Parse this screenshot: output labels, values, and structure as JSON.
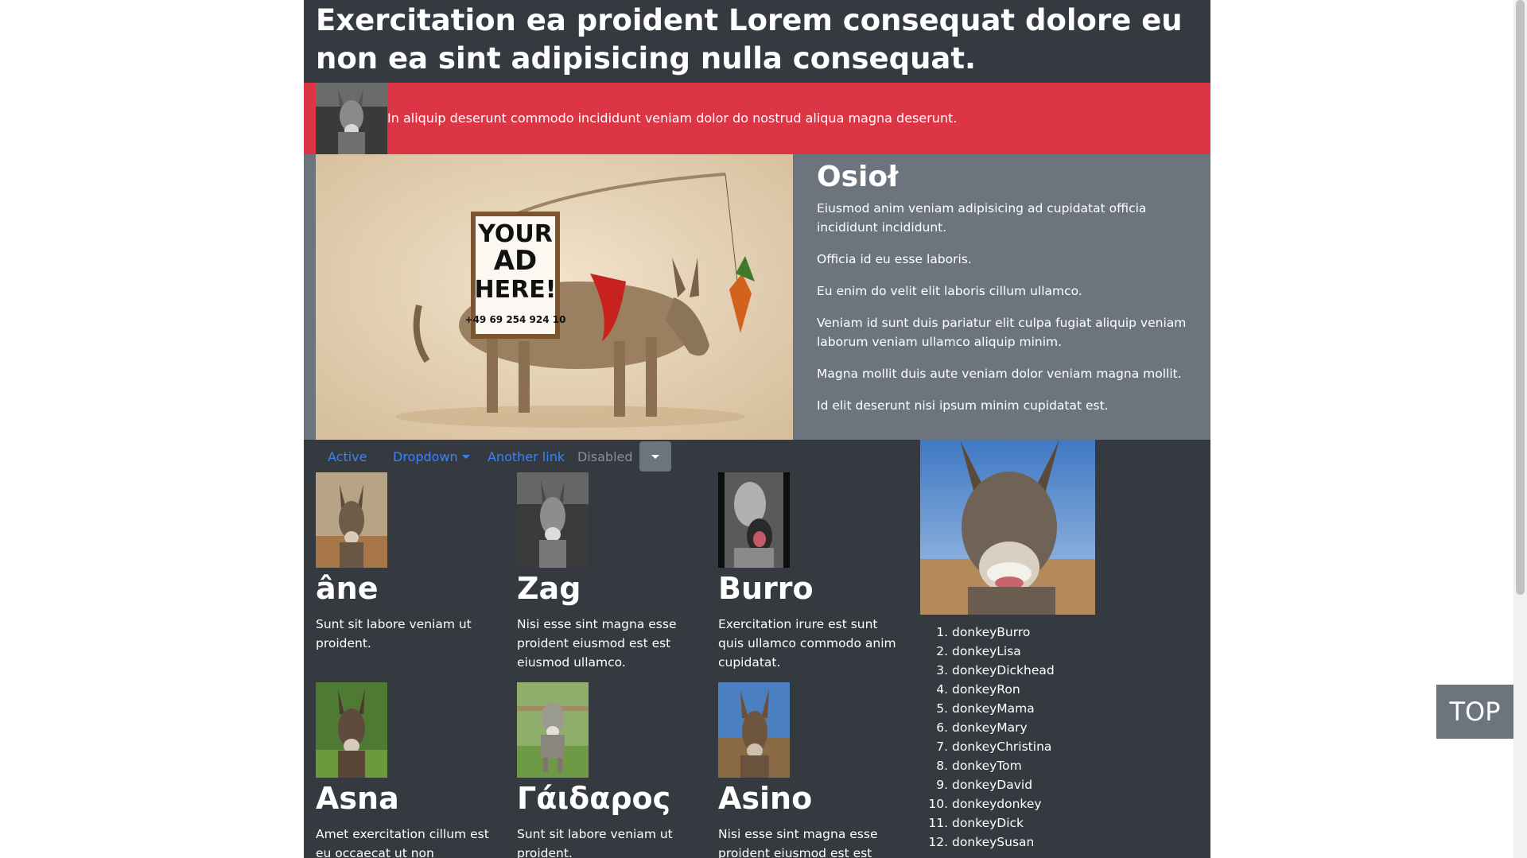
{
  "header": {
    "title": "Exercitation ea proident Lorem consequat dolore eu non ea sint adipisicing nulla consequat."
  },
  "alert": {
    "text": "In aliquip deserunt commodo incididunt veniam dolor do nostrud aliqua magna deserunt."
  },
  "hero": {
    "image_sign_lines": [
      "YOUR",
      "AD",
      "HERE!"
    ],
    "image_phone": "+49 69 254 924 10",
    "title": "Osioł",
    "paragraphs": [
      "Eiusmod anim veniam adipisicing ad cupidatat officia incididunt incididunt.",
      "Officia id eu esse laboris.",
      "Eu enim do velit elit laboris cillum ullamco.",
      "Veniam id sunt duis pariatur elit culpa fugiat aliquip veniam laborum veniam ullamco aliquip minim.",
      "Magna mollit duis aute veniam dolor veniam magna mollit.",
      "Id elit deserunt nisi ipsum minim cupidatat est."
    ]
  },
  "nav": {
    "active": "Active",
    "dropdown": "Dropdown",
    "another": "Another link",
    "disabled": "Disabled"
  },
  "cards": [
    {
      "title": "âne",
      "text": "Sunt sit labore veniam ut proident."
    },
    {
      "title": "Zag",
      "text": "Nisi esse sint magna esse proident eiusmod est est eiusmod ullamco."
    },
    {
      "title": "Burro",
      "text": "Exercitation irure est sunt quis ullamco commodo anim cupidatat."
    },
    {
      "title": "Asna",
      "text": "Amet exercitation cillum est eu occaecat ut non consequat."
    },
    {
      "title": "Γάιδαρος",
      "text": "Sunt sit labore veniam ut proident."
    },
    {
      "title": "Asino",
      "text": "Nisi esse sint magna esse proident eiusmod est est"
    }
  ],
  "list": [
    "donkeyBurro",
    "donkeyLisa",
    "donkeyDickhead",
    "donkeyRon",
    "donkeyMama",
    "donkeyMary",
    "donkeyChristina",
    "donkeyTom",
    "donkeyDavid",
    "donkeydonkey",
    "donkeyDick",
    "donkeySusan"
  ],
  "top_button": "TOP",
  "colors": {
    "page_bg": "#343a40",
    "alert_bg": "#dc3545",
    "hero_bg": "#6c757d",
    "link": "#3b82f6"
  }
}
